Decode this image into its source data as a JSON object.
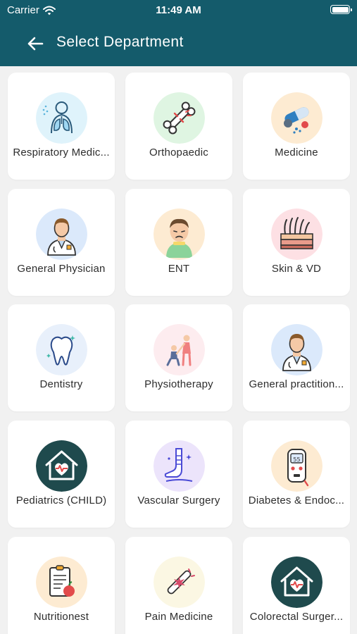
{
  "status_bar": {
    "carrier": "Carrier",
    "time": "11:49 AM"
  },
  "header": {
    "title": "Select Department"
  },
  "departments": [
    {
      "label": "Respiratory Medic...",
      "icon": "lungs-icon",
      "bg": "#dff3fb"
    },
    {
      "label": "Orthopaedic",
      "icon": "bone-icon",
      "bg": "#dff5e2"
    },
    {
      "label": "Medicine",
      "icon": "pills-icon",
      "bg": "#fdebd2"
    },
    {
      "label": "General Physician",
      "icon": "doctor-icon",
      "bg": "#dbe9fb"
    },
    {
      "label": "ENT",
      "icon": "sick-person-icon",
      "bg": "#fdebd2"
    },
    {
      "label": "Skin & VD",
      "icon": "skin-layers-icon",
      "bg": "#fde0e4"
    },
    {
      "label": "Dentistry",
      "icon": "tooth-icon",
      "bg": "#e8f0fb"
    },
    {
      "label": "Physiotherapy",
      "icon": "physio-icon",
      "bg": "#fdecef"
    },
    {
      "label": "General practition...",
      "icon": "doctor-icon",
      "bg": "#dbe9fb"
    },
    {
      "label": "Pediatrics (CHILD)",
      "icon": "clinic-house-icon",
      "bg": "#1f4a4d"
    },
    {
      "label": "Vascular Surgery",
      "icon": "leg-bandage-icon",
      "bg": "#ece4fb"
    },
    {
      "label": "Diabetes & Endoc...",
      "icon": "glucometer-icon",
      "bg": "#fdebd2"
    },
    {
      "label": "Nutritionest",
      "icon": "diet-clipboard-icon",
      "bg": "#fdebd2"
    },
    {
      "label": "Pain Medicine",
      "icon": "joint-pain-icon",
      "bg": "#fbf7e3"
    },
    {
      "label": "Colorectal Surger...",
      "icon": "clinic-house-icon",
      "bg": "#1f4a4d"
    }
  ],
  "colors": {
    "header": "#145b6b",
    "background": "#f1f1f1",
    "card": "#ffffff"
  }
}
